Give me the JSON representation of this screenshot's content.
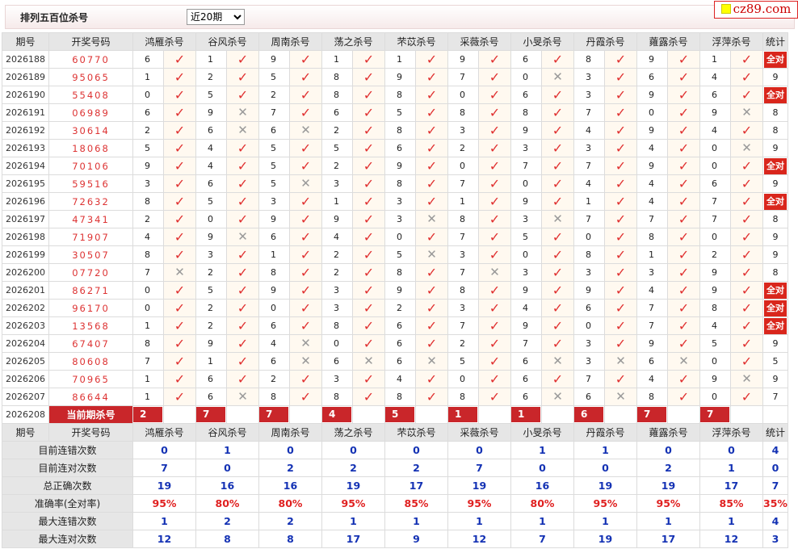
{
  "header": {
    "title": "排列五百位杀号",
    "period_select": "近20期",
    "period_options": [
      "近20期"
    ],
    "logo": "cz89.com"
  },
  "columns": {
    "id": "期号",
    "draw": "开奖号码",
    "experts": [
      "鸿雁杀号",
      "谷风杀号",
      "周南杀号",
      "荡之杀号",
      "芣苡杀号",
      "采薇杀号",
      "小旻杀号",
      "丹霞杀号",
      "蕹露杀号",
      "浮萍杀号"
    ],
    "stat": "统计"
  },
  "all_right_label": "全对",
  "rows": [
    {
      "id": "2026188",
      "draw": "60770",
      "kills": [
        [
          "6",
          1
        ],
        [
          "1",
          1
        ],
        [
          "9",
          1
        ],
        [
          "1",
          1
        ],
        [
          "1",
          1
        ],
        [
          "9",
          1
        ],
        [
          "6",
          1
        ],
        [
          "8",
          1
        ],
        [
          "9",
          1
        ],
        [
          "1",
          1
        ]
      ],
      "stat": "全对"
    },
    {
      "id": "2026189",
      "draw": "95065",
      "kills": [
        [
          "1",
          1
        ],
        [
          "2",
          1
        ],
        [
          "5",
          1
        ],
        [
          "8",
          1
        ],
        [
          "9",
          1
        ],
        [
          "7",
          1
        ],
        [
          "0",
          0
        ],
        [
          "3",
          1
        ],
        [
          "6",
          1
        ],
        [
          "4",
          1
        ]
      ],
      "stat": "9"
    },
    {
      "id": "2026190",
      "draw": "55408",
      "kills": [
        [
          "0",
          1
        ],
        [
          "5",
          1
        ],
        [
          "2",
          1
        ],
        [
          "8",
          1
        ],
        [
          "8",
          1
        ],
        [
          "0",
          1
        ],
        [
          "6",
          1
        ],
        [
          "3",
          1
        ],
        [
          "9",
          1
        ],
        [
          "6",
          1
        ]
      ],
      "stat": "全对"
    },
    {
      "id": "2026191",
      "draw": "06989",
      "kills": [
        [
          "6",
          1
        ],
        [
          "9",
          0
        ],
        [
          "7",
          1
        ],
        [
          "6",
          1
        ],
        [
          "5",
          1
        ],
        [
          "8",
          1
        ],
        [
          "8",
          1
        ],
        [
          "7",
          1
        ],
        [
          "0",
          1
        ],
        [
          "9",
          0
        ]
      ],
      "stat": "8"
    },
    {
      "id": "2026192",
      "draw": "30614",
      "kills": [
        [
          "2",
          1
        ],
        [
          "6",
          0
        ],
        [
          "6",
          0
        ],
        [
          "2",
          1
        ],
        [
          "8",
          1
        ],
        [
          "3",
          1
        ],
        [
          "9",
          1
        ],
        [
          "4",
          1
        ],
        [
          "9",
          1
        ],
        [
          "4",
          1
        ]
      ],
      "stat": "8"
    },
    {
      "id": "2026193",
      "draw": "18068",
      "kills": [
        [
          "5",
          1
        ],
        [
          "4",
          1
        ],
        [
          "5",
          1
        ],
        [
          "5",
          1
        ],
        [
          "6",
          1
        ],
        [
          "2",
          1
        ],
        [
          "3",
          1
        ],
        [
          "3",
          1
        ],
        [
          "4",
          1
        ],
        [
          "0",
          0
        ]
      ],
      "stat": "9"
    },
    {
      "id": "2026194",
      "draw": "70106",
      "kills": [
        [
          "9",
          1
        ],
        [
          "4",
          1
        ],
        [
          "5",
          1
        ],
        [
          "2",
          1
        ],
        [
          "9",
          1
        ],
        [
          "0",
          1
        ],
        [
          "7",
          1
        ],
        [
          "7",
          1
        ],
        [
          "9",
          1
        ],
        [
          "0",
          1
        ]
      ],
      "stat": "全对"
    },
    {
      "id": "2026195",
      "draw": "59516",
      "kills": [
        [
          "3",
          1
        ],
        [
          "6",
          1
        ],
        [
          "5",
          0
        ],
        [
          "3",
          1
        ],
        [
          "8",
          1
        ],
        [
          "7",
          1
        ],
        [
          "0",
          1
        ],
        [
          "4",
          1
        ],
        [
          "4",
          1
        ],
        [
          "6",
          1
        ]
      ],
      "stat": "9"
    },
    {
      "id": "2026196",
      "draw": "72632",
      "kills": [
        [
          "8",
          1
        ],
        [
          "5",
          1
        ],
        [
          "3",
          1
        ],
        [
          "1",
          1
        ],
        [
          "3",
          1
        ],
        [
          "1",
          1
        ],
        [
          "9",
          1
        ],
        [
          "1",
          1
        ],
        [
          "4",
          1
        ],
        [
          "7",
          1
        ]
      ],
      "stat": "全对"
    },
    {
      "id": "2026197",
      "draw": "47341",
      "kills": [
        [
          "2",
          1
        ],
        [
          "0",
          1
        ],
        [
          "9",
          1
        ],
        [
          "9",
          1
        ],
        [
          "3",
          0
        ],
        [
          "8",
          1
        ],
        [
          "3",
          0
        ],
        [
          "7",
          1
        ],
        [
          "7",
          1
        ],
        [
          "7",
          1
        ]
      ],
      "stat": "8"
    },
    {
      "id": "2026198",
      "draw": "71907",
      "kills": [
        [
          "4",
          1
        ],
        [
          "9",
          0
        ],
        [
          "6",
          1
        ],
        [
          "4",
          1
        ],
        [
          "0",
          1
        ],
        [
          "7",
          1
        ],
        [
          "5",
          1
        ],
        [
          "0",
          1
        ],
        [
          "8",
          1
        ],
        [
          "0",
          1
        ]
      ],
      "stat": "9"
    },
    {
      "id": "2026199",
      "draw": "30507",
      "kills": [
        [
          "8",
          1
        ],
        [
          "3",
          1
        ],
        [
          "1",
          1
        ],
        [
          "2",
          1
        ],
        [
          "5",
          0
        ],
        [
          "3",
          1
        ],
        [
          "0",
          1
        ],
        [
          "8",
          1
        ],
        [
          "1",
          1
        ],
        [
          "2",
          1
        ]
      ],
      "stat": "9"
    },
    {
      "id": "2026200",
      "draw": "07720",
      "kills": [
        [
          "7",
          0
        ],
        [
          "2",
          1
        ],
        [
          "8",
          1
        ],
        [
          "2",
          1
        ],
        [
          "8",
          1
        ],
        [
          "7",
          0
        ],
        [
          "3",
          1
        ],
        [
          "3",
          1
        ],
        [
          "3",
          1
        ],
        [
          "9",
          1
        ]
      ],
      "stat": "8"
    },
    {
      "id": "2026201",
      "draw": "86271",
      "kills": [
        [
          "0",
          1
        ],
        [
          "5",
          1
        ],
        [
          "9",
          1
        ],
        [
          "3",
          1
        ],
        [
          "9",
          1
        ],
        [
          "8",
          1
        ],
        [
          "9",
          1
        ],
        [
          "9",
          1
        ],
        [
          "4",
          1
        ],
        [
          "9",
          1
        ]
      ],
      "stat": "全对"
    },
    {
      "id": "2026202",
      "draw": "96170",
      "kills": [
        [
          "0",
          1
        ],
        [
          "2",
          1
        ],
        [
          "0",
          1
        ],
        [
          "3",
          1
        ],
        [
          "2",
          1
        ],
        [
          "3",
          1
        ],
        [
          "4",
          1
        ],
        [
          "6",
          1
        ],
        [
          "7",
          1
        ],
        [
          "8",
          1
        ]
      ],
      "stat": "全对"
    },
    {
      "id": "2026203",
      "draw": "13568",
      "kills": [
        [
          "1",
          1
        ],
        [
          "2",
          1
        ],
        [
          "6",
          1
        ],
        [
          "8",
          1
        ],
        [
          "6",
          1
        ],
        [
          "7",
          1
        ],
        [
          "9",
          1
        ],
        [
          "0",
          1
        ],
        [
          "7",
          1
        ],
        [
          "4",
          1
        ]
      ],
      "stat": "全对"
    },
    {
      "id": "2026204",
      "draw": "67407",
      "kills": [
        [
          "8",
          1
        ],
        [
          "9",
          1
        ],
        [
          "4",
          0
        ],
        [
          "0",
          1
        ],
        [
          "6",
          1
        ],
        [
          "2",
          1
        ],
        [
          "7",
          1
        ],
        [
          "3",
          1
        ],
        [
          "9",
          1
        ],
        [
          "5",
          1
        ]
      ],
      "stat": "9"
    },
    {
      "id": "2026205",
      "draw": "80608",
      "kills": [
        [
          "7",
          1
        ],
        [
          "1",
          1
        ],
        [
          "6",
          0
        ],
        [
          "6",
          0
        ],
        [
          "6",
          0
        ],
        [
          "5",
          1
        ],
        [
          "6",
          0
        ],
        [
          "3",
          0
        ],
        [
          "6",
          0
        ],
        [
          "0",
          1
        ]
      ],
      "stat": "5"
    },
    {
      "id": "2026206",
      "draw": "70965",
      "kills": [
        [
          "1",
          1
        ],
        [
          "6",
          1
        ],
        [
          "2",
          1
        ],
        [
          "3",
          1
        ],
        [
          "4",
          1
        ],
        [
          "0",
          1
        ],
        [
          "6",
          1
        ],
        [
          "7",
          1
        ],
        [
          "4",
          1
        ],
        [
          "9",
          0
        ]
      ],
      "stat": "9"
    },
    {
      "id": "2026207",
      "draw": "86644",
      "kills": [
        [
          "1",
          1
        ],
        [
          "6",
          0
        ],
        [
          "8",
          1
        ],
        [
          "8",
          1
        ],
        [
          "8",
          1
        ],
        [
          "8",
          1
        ],
        [
          "6",
          0
        ],
        [
          "6",
          0
        ],
        [
          "8",
          1
        ],
        [
          "0",
          1
        ]
      ],
      "stat": "7"
    }
  ],
  "current": {
    "id": "2026208",
    "label": "当前期杀号",
    "kills": [
      "2",
      "7",
      "7",
      "4",
      "5",
      "1",
      "1",
      "6",
      "7",
      "7"
    ]
  },
  "stats": [
    {
      "label": "目前连错次数",
      "values": [
        "0",
        "1",
        "0",
        "0",
        "0",
        "0",
        "1",
        "1",
        "0",
        "0",
        "4"
      ]
    },
    {
      "label": "目前连对次数",
      "values": [
        "7",
        "0",
        "2",
        "2",
        "2",
        "7",
        "0",
        "0",
        "2",
        "1",
        "0"
      ]
    },
    {
      "label": "总正确次数",
      "values": [
        "19",
        "16",
        "16",
        "19",
        "17",
        "19",
        "16",
        "19",
        "19",
        "17",
        "7"
      ]
    },
    {
      "label": "准确率(全对率)",
      "values": [
        "95%",
        "80%",
        "80%",
        "95%",
        "85%",
        "95%",
        "80%",
        "95%",
        "95%",
        "85%",
        "35%"
      ],
      "percent": true
    },
    {
      "label": "最大连错次数",
      "values": [
        "1",
        "2",
        "2",
        "1",
        "1",
        "1",
        "1",
        "1",
        "1",
        "1",
        "4"
      ]
    },
    {
      "label": "最大连对次数",
      "values": [
        "12",
        "8",
        "8",
        "17",
        "9",
        "12",
        "7",
        "19",
        "17",
        "12",
        "3"
      ]
    }
  ]
}
